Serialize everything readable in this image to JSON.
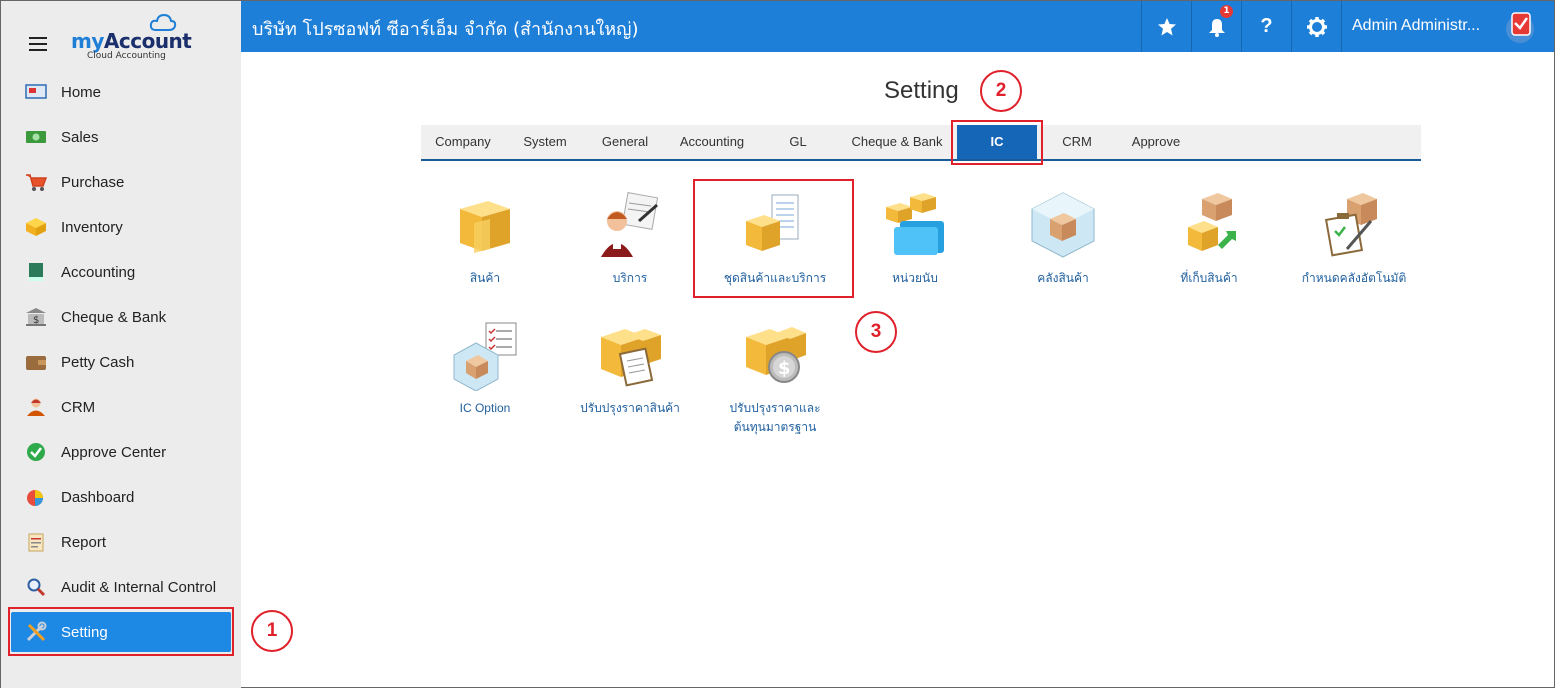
{
  "header": {
    "company": "บริษัท โปรซอฟท์ ซีอาร์เอ็ม จำกัด (สำนักงานใหญ่)",
    "notification_count": "1",
    "user_name": "Admin Administr..."
  },
  "brand": {
    "name_my": "my",
    "name_main": "Account",
    "subtitle": "Cloud Accounting"
  },
  "sidebar": {
    "items": [
      {
        "label": "Home",
        "icon": "home-icon"
      },
      {
        "label": "Sales",
        "icon": "money-icon"
      },
      {
        "label": "Purchase",
        "icon": "cart-icon"
      },
      {
        "label": "Inventory",
        "icon": "box-icon"
      },
      {
        "label": "Accounting",
        "icon": "book-icon"
      },
      {
        "label": "Cheque & Bank",
        "icon": "bank-icon"
      },
      {
        "label": "Petty Cash",
        "icon": "wallet-icon"
      },
      {
        "label": "CRM",
        "icon": "people-icon"
      },
      {
        "label": "Approve Center",
        "icon": "check-circle-icon"
      },
      {
        "label": "Dashboard",
        "icon": "pie-chart-icon"
      },
      {
        "label": "Report",
        "icon": "report-icon"
      },
      {
        "label": "Audit & Internal Control",
        "icon": "magnifier-icon"
      },
      {
        "label": "Setting",
        "icon": "tools-icon"
      }
    ]
  },
  "main": {
    "title": "Setting",
    "tabs": [
      "Company",
      "System",
      "General",
      "Accounting",
      "GL",
      "Cheque & Bank",
      "IC",
      "CRM",
      "Approve"
    ],
    "active_tab": "IC",
    "tiles": [
      {
        "label": "สินค้า",
        "icon": "product-box-icon"
      },
      {
        "label": "บริการ",
        "icon": "service-person-icon"
      },
      {
        "label": "ชุดสินค้าและบริการ",
        "icon": "product-set-icon"
      },
      {
        "label": "หน่วยนับ",
        "icon": "unit-folder-icon"
      },
      {
        "label": "คลังสินค้า",
        "icon": "warehouse-icon"
      },
      {
        "label": "ที่เก็บสินค้า",
        "icon": "storage-location-icon"
      },
      {
        "label": "กำหนดคลังอัตโนมัติ",
        "icon": "auto-warehouse-icon"
      },
      {
        "label": "IC Option",
        "icon": "ic-option-icon"
      },
      {
        "label": "ปรับปรุงราคาสินค้า",
        "icon": "price-adjust-icon"
      },
      {
        "label": "ปรับปรุงราคาและ",
        "label2": "ต้นทุนมาตรฐาน",
        "icon": "standard-cost-icon"
      }
    ]
  },
  "annotations": [
    "1",
    "2",
    "3"
  ],
  "colors": {
    "topbar": "#1e7fd8",
    "active": "#1e88e5",
    "highlight": "#e0202a",
    "tab_active": "#1566b7"
  }
}
